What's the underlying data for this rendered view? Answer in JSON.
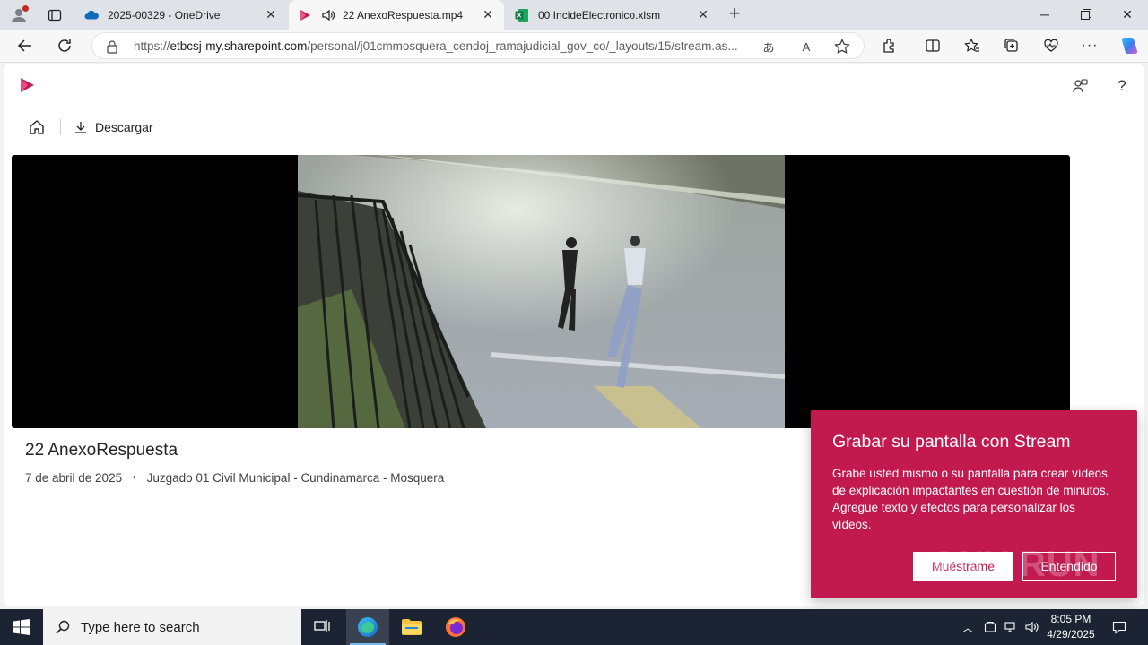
{
  "browser": {
    "tabs": [
      {
        "title": "2025-00329 - OneDrive",
        "icon": "onedrive-icon"
      },
      {
        "title": "22 AnexoRespuesta.mp4",
        "icon": "stream-icon",
        "audio": true
      },
      {
        "title": "00 IncideElectronico.xlsm",
        "icon": "excel-icon"
      }
    ],
    "address": {
      "prefix": "https://",
      "domain": "etbcsj-my.sharepoint.com",
      "path": "/personal/j01cmmosquera_cendoj_ramajudicial_gov_co/_layouts/15/stream.as..."
    }
  },
  "page": {
    "download_label": "Descargar",
    "video_title": "22 AnexoRespuesta",
    "date": "7 de abril de 2025",
    "owner": "Juzgado 01 Civil Municipal - Cundinamarca - Mosquera"
  },
  "callout": {
    "title": "Grabar su pantalla con Stream",
    "body": "Grabe usted mismo o su pantalla para crear vídeos de explicación impactantes en cuestión de minutos. Agregue texto y efectos para personalizar los vídeos.",
    "primary": "Muéstrame",
    "secondary": "Entendido"
  },
  "watermark": "ANY RUN",
  "taskbar": {
    "search_placeholder": "Type here to search",
    "time": "8:05 PM",
    "date": "4/29/2025"
  },
  "colors": {
    "accent": "#c2194f",
    "taskbar": "#1c2433"
  }
}
